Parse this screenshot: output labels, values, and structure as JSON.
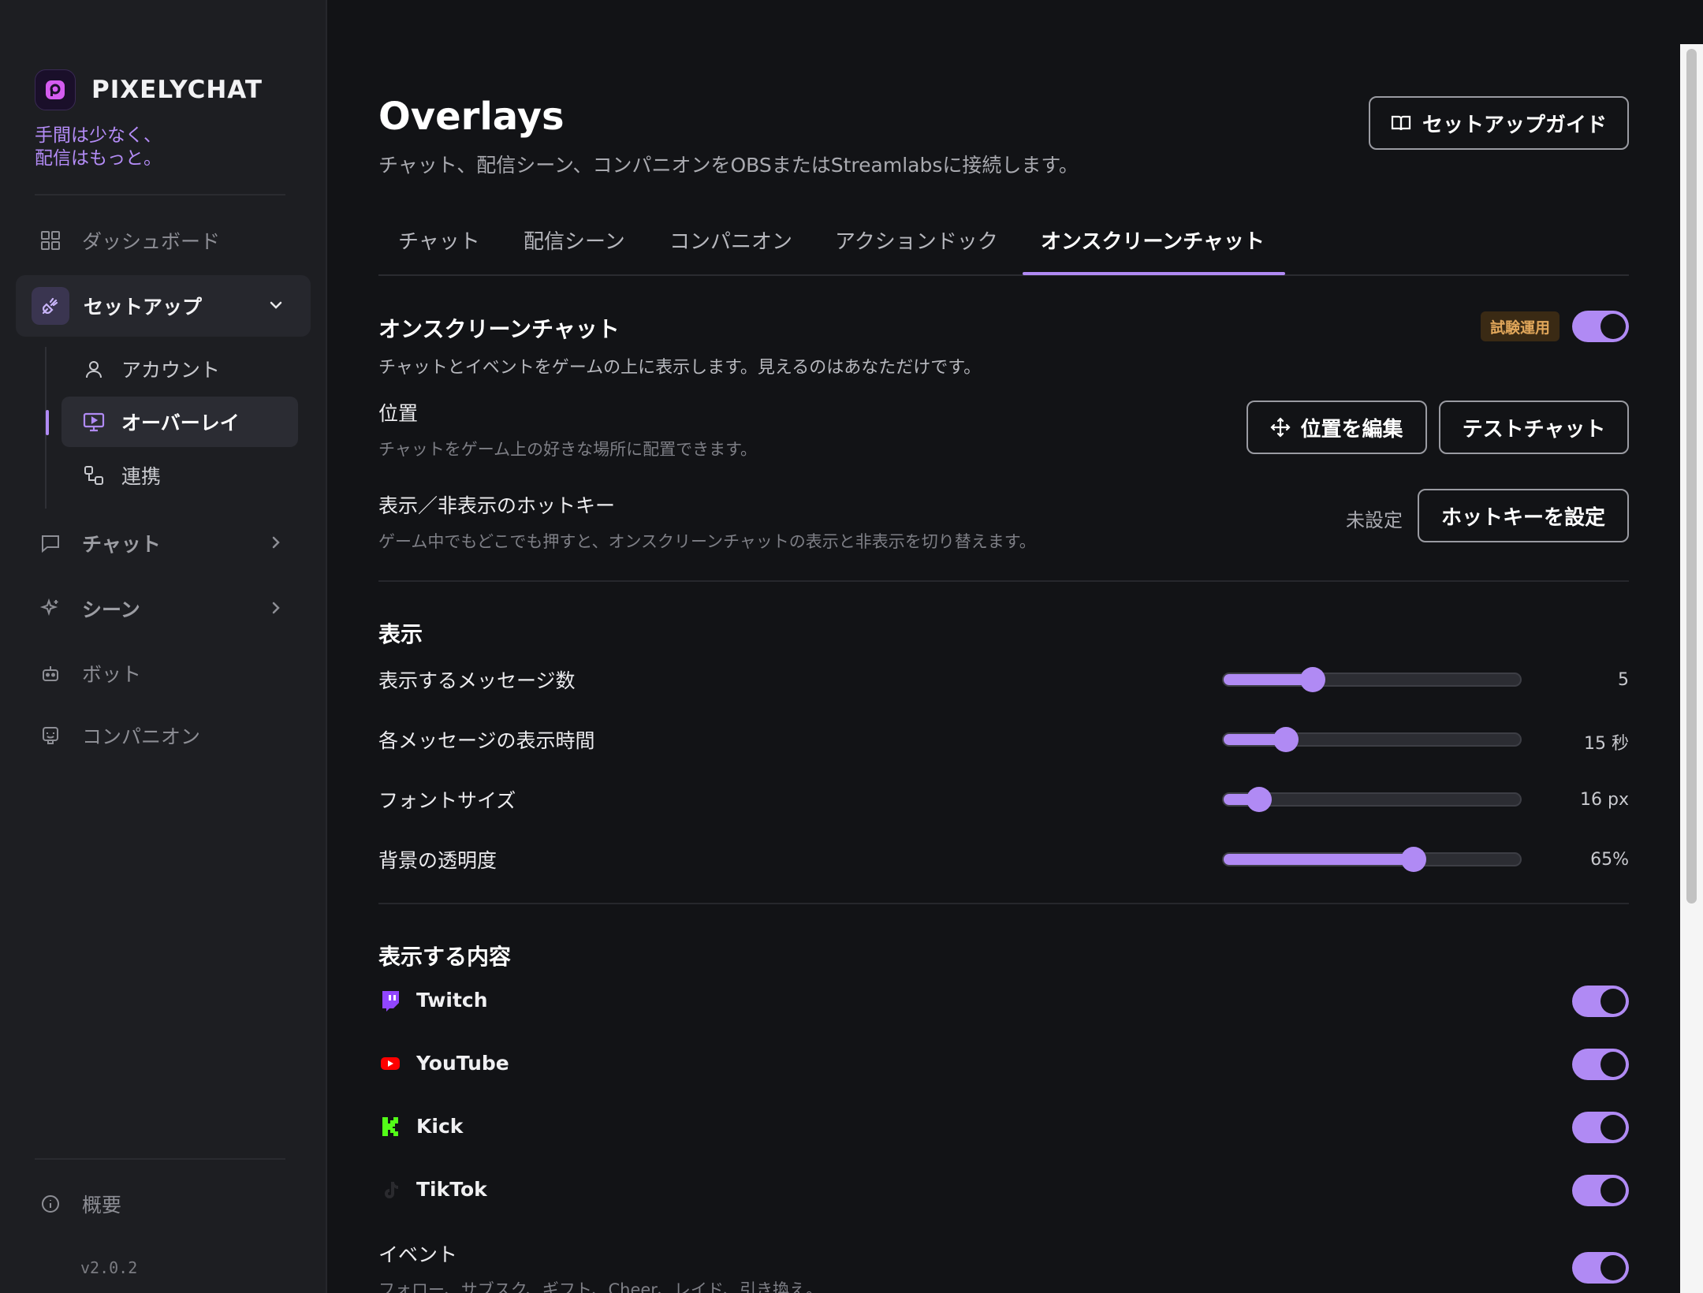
{
  "brand": {
    "name": "PIXELYCHAT",
    "tagline_1": "手間は少なく、",
    "tagline_2": "配信はもっと。"
  },
  "sidebar": {
    "dashboard": "ダッシュボード",
    "setup": "セットアップ",
    "sub": {
      "account": "アカウント",
      "overlay": "オーバーレイ",
      "integrations": "連携"
    },
    "chat": "チャット",
    "scenes": "シーン",
    "bot": "ボット",
    "companion": "コンパニオン",
    "about": "概要",
    "version": "v2.0.2"
  },
  "header": {
    "title": "Overlays",
    "subtitle": "チャット、配信シーン、コンパニオンをOBSまたはStreamlabsに接続します。",
    "guide_button": "セットアップガイド"
  },
  "tabs": [
    "チャット",
    "配信シーン",
    "コンパニオン",
    "アクションドック",
    "オンスクリーンチャット"
  ],
  "onscreen": {
    "title": "オンスクリーンチャット",
    "badge": "試験運用",
    "enabled": true,
    "description": "チャットとイベントをゲームの上に表示します。見えるのはあなただけです。",
    "position_label": "位置",
    "position_desc": "チャットをゲーム上の好きな場所に配置できます。",
    "edit_position": "位置を編集",
    "test_chat": "テストチャット",
    "hotkey_label": "表示／非表示のホットキー",
    "hotkey_desc": "ゲーム中でもどこでも押すと、オンスクリーンチャットの表示と非表示を切り替えます。",
    "hotkey_status": "未設定",
    "set_hotkey": "ホットキーを設定"
  },
  "display": {
    "title": "表示",
    "sliders": [
      {
        "label": "表示するメッセージ数",
        "value_text": "5",
        "fraction": 0.3
      },
      {
        "label": "各メッセージの表示時間",
        "value_text": "15 秒",
        "fraction": 0.21
      },
      {
        "label": "フォントサイズ",
        "value_text": "16 px",
        "fraction": 0.12
      },
      {
        "label": "背景の透明度",
        "value_text": "65%",
        "fraction": 0.64
      }
    ]
  },
  "content": {
    "title": "表示する内容",
    "sources": [
      {
        "label": "Twitch",
        "icon": "twitch-icon",
        "color": "#9146ff",
        "enabled": true
      },
      {
        "label": "YouTube",
        "icon": "youtube-icon",
        "color": "#ff0000",
        "enabled": true
      },
      {
        "label": "Kick",
        "icon": "kick-icon",
        "color": "#53fc18",
        "enabled": true
      },
      {
        "label": "TikTok",
        "icon": "tiktok-icon",
        "color": "#111111",
        "enabled": true
      }
    ],
    "events_label": "イベント",
    "events_desc": "フォロー、サブスク、ギフト、Cheer、レイド、引き換え。"
  },
  "colors": {
    "accent": "#b08af4",
    "badge_bg": "#3a2a14",
    "badge_text": "#e0a65a",
    "background": "#121316",
    "sidebar": "#1d1e22"
  }
}
